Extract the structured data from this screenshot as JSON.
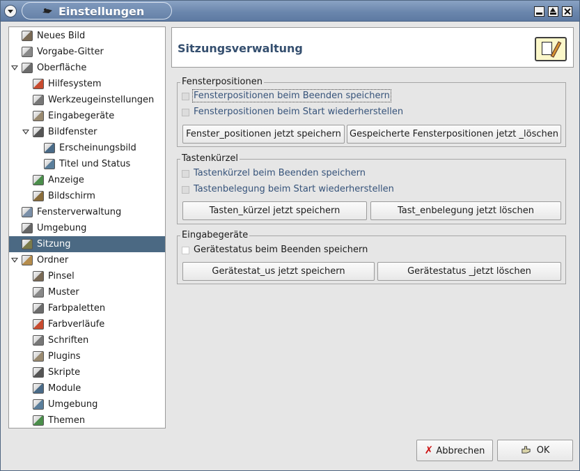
{
  "window": {
    "title": "Einstellungen",
    "buttons": [
      "minimize",
      "maximize",
      "close"
    ]
  },
  "tree": {
    "items": [
      {
        "label": "Neues Bild",
        "icon": "new-image-icon",
        "indent": 1
      },
      {
        "label": "Vorgabe-Gitter",
        "icon": "grid-icon",
        "indent": 1
      },
      {
        "label": "Oberfläche",
        "icon": "interface-icon",
        "indent": 1,
        "expander": "expanded"
      },
      {
        "label": "Hilfesystem",
        "icon": "help-system-icon",
        "indent": 2
      },
      {
        "label": "Werkzeugeinstellungen",
        "icon": "tool-options-icon",
        "indent": 2
      },
      {
        "label": "Eingabegeräte",
        "icon": "input-devices-icon",
        "indent": 2
      },
      {
        "label": "Bildfenster",
        "icon": "image-window-icon",
        "indent": 2,
        "expander": "expanded"
      },
      {
        "label": "Erscheinungsbild",
        "icon": "appearance-icon",
        "indent": 3
      },
      {
        "label": "Titel und Status",
        "icon": "title-status-icon",
        "indent": 3
      },
      {
        "label": "Anzeige",
        "icon": "display-icon",
        "indent": 2
      },
      {
        "label": "Bildschirm",
        "icon": "monitor-icon",
        "indent": 2
      },
      {
        "label": "Fensterverwaltung",
        "icon": "window-management-icon",
        "indent": 1
      },
      {
        "label": "Umgebung",
        "icon": "environment-icon",
        "indent": 1
      },
      {
        "label": "Sitzung",
        "icon": "session-icon",
        "indent": 1,
        "selected": true
      },
      {
        "label": "Ordner",
        "icon": "folders-icon",
        "indent": 1,
        "expander": "expanded"
      },
      {
        "label": "Pinsel",
        "icon": "brush-folder-icon",
        "indent": 2
      },
      {
        "label": "Muster",
        "icon": "pattern-folder-icon",
        "indent": 2
      },
      {
        "label": "Farbpaletten",
        "icon": "palette-folder-icon",
        "indent": 2
      },
      {
        "label": "Farbverläufe",
        "icon": "gradient-folder-icon",
        "indent": 2
      },
      {
        "label": "Schriften",
        "icon": "font-folder-icon",
        "indent": 2
      },
      {
        "label": "Plugins",
        "icon": "plugin-folder-icon",
        "indent": 2
      },
      {
        "label": "Skripte",
        "icon": "script-folder-icon",
        "indent": 2
      },
      {
        "label": "Module",
        "icon": "module-folder-icon",
        "indent": 2
      },
      {
        "label": "Umgebung",
        "icon": "environment-folder-icon",
        "indent": 2
      },
      {
        "label": "Themen",
        "icon": "theme-folder-icon",
        "indent": 2
      }
    ]
  },
  "panel": {
    "title": "Sitzungsverwaltung",
    "icon": "session-panel-icon"
  },
  "groups": {
    "window_positions": {
      "title": "Fensterpositionen",
      "check1": "Fensterpositionen beim Beenden speichern",
      "check2": "Fensterpositionen beim Start wiederherstellen",
      "button1": "Fenster_positionen jetzt speichern",
      "button2": "Gespeicherte Fensterpositionen jetzt _löschen"
    },
    "shortcuts": {
      "title": "Tastenkürzel",
      "check1": "Tastenkürzel beim Beenden speichern",
      "check2": "Tastenbelegung beim Start wiederherstellen",
      "button1": "Tasten_kürzel jetzt speichern",
      "button2": "Tast_enbelegung jetzt löschen"
    },
    "input_devices": {
      "title": "Eingabegeräte",
      "check1": "Gerätestatus beim Beenden speichern",
      "button1": "Gerätestat_us jetzt speichern",
      "button2": "Gerätestatus _jetzt löschen"
    }
  },
  "footer": {
    "cancel_label": "Abbrechen",
    "ok_label": "OK"
  }
}
